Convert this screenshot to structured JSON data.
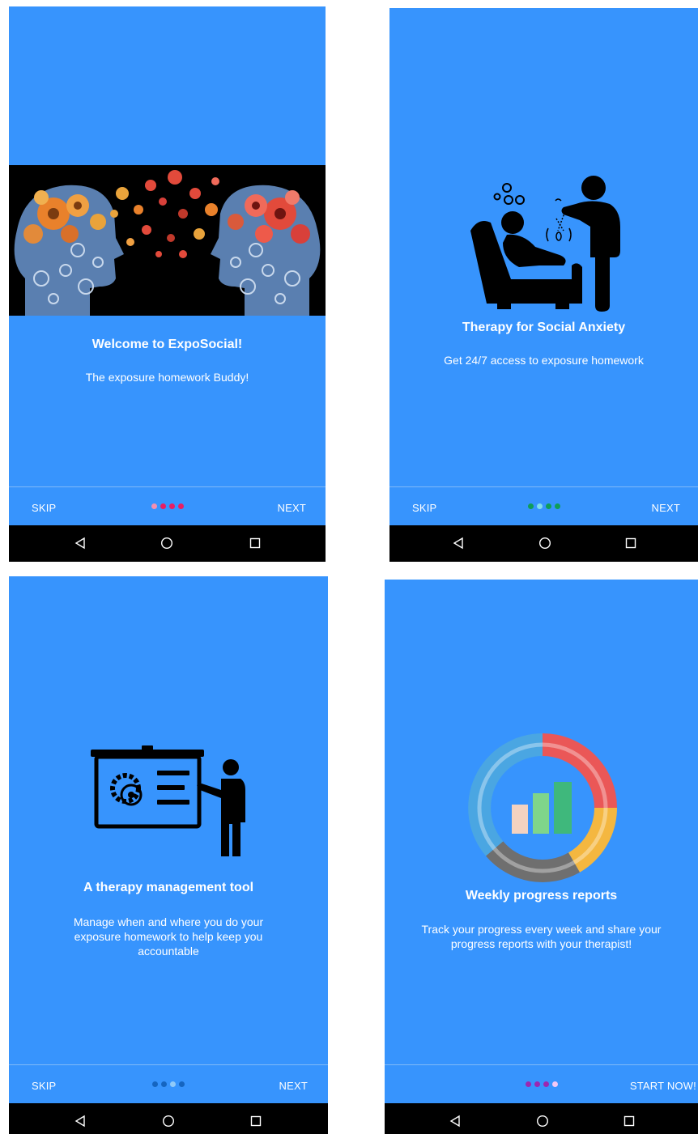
{
  "screens": [
    {
      "title": "Welcome to ExpoSocial!",
      "subtitle": [
        "The exposure homework Buddy!"
      ],
      "skip_label": "SKIP",
      "next_label": "NEXT",
      "dots": [
        "#f48fb1",
        "#e91e63",
        "#e91e63",
        "#e91e63"
      ]
    },
    {
      "title": "Therapy for Social Anxiety",
      "subtitle": [
        "Get 24/7 access to exposure homework"
      ],
      "skip_label": "SKIP",
      "next_label": "NEXT",
      "dots": [
        "#0f9d58",
        "#80deea",
        "#0f9d58",
        "#0f9d58"
      ]
    },
    {
      "title": "A therapy management tool",
      "subtitle": [
        "Manage when and where you do your",
        "exposure homework to help keep you",
        "accountable"
      ],
      "skip_label": "SKIP",
      "next_label": "NEXT",
      "dots": [
        "#1565c0",
        "#1565c0",
        "#90caf9",
        "#1565c0"
      ]
    },
    {
      "title": "Weekly progress reports",
      "subtitle": [
        "Track your progress every week and share your",
        "progress reports with your therapist!"
      ],
      "skip_label": "",
      "next_label": "START NOW!",
      "dots": [
        "#9c27b0",
        "#9c27b0",
        "#9c27b0",
        "#f3c8f5"
      ]
    }
  ],
  "colors": {
    "background": "#3794fd",
    "navbar": "#000000",
    "text": "#ffffff"
  },
  "icons": {
    "screen1": "brain-gears-image",
    "screen2": "therapist-hypnosis-icon",
    "screen3": "presentation-gear-icon",
    "screen4": "progress-donut-chart-icon",
    "nav": [
      "back-triangle-icon",
      "home-circle-icon",
      "recents-square-icon"
    ]
  }
}
